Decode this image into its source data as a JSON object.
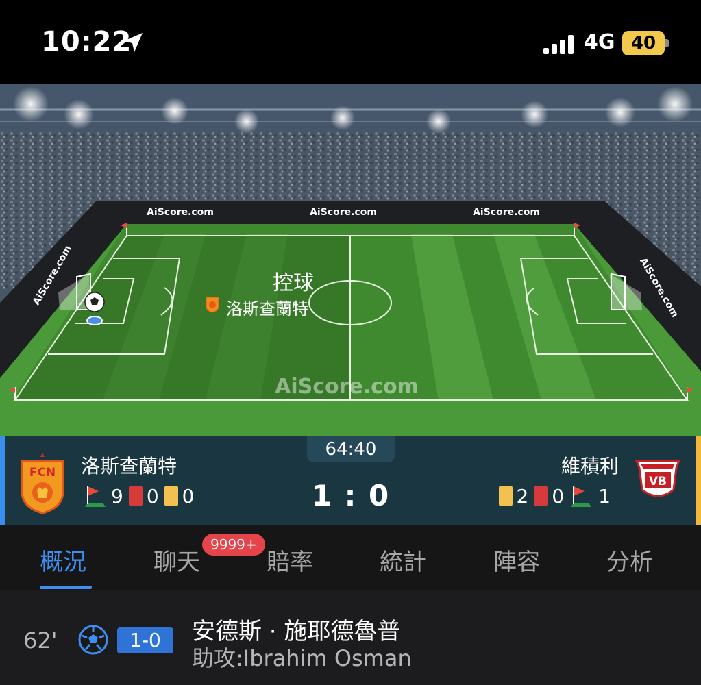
{
  "status_bar": {
    "time": "10:22",
    "network": "4G",
    "battery": "40",
    "icons": [
      "location-arrow-icon",
      "signal-bars-icon",
      "battery-icon"
    ]
  },
  "pitch": {
    "watermarks": [
      "AiScore.com",
      "AiScore.com",
      "AiScore.com",
      "AiScore.com",
      "AiScore.com",
      "AiScore.com"
    ],
    "possession_label": "控球",
    "possession_team": "洛斯查蘭特"
  },
  "match": {
    "clock": "64:40",
    "score": "1 : 0",
    "home": {
      "name": "洛斯查蘭特",
      "logo_text": "FCN",
      "corners": "9",
      "red_cards": "0",
      "yellow_cards": "0"
    },
    "away": {
      "name": "維積利",
      "logo_text": "VB",
      "yellow_cards": "2",
      "red_cards": "0",
      "corners": "1"
    }
  },
  "tabs": {
    "items": [
      "概況",
      "聊天",
      "賠率",
      "統計",
      "陣容",
      "分析"
    ],
    "active": "概況",
    "chat_badge": "9999+"
  },
  "event": {
    "minute": "62'",
    "score": "1-0",
    "scorer": "安德斯 · 施耶德魯普",
    "assist": "助攻:Ibrahim Osman"
  },
  "colors": {
    "accent_blue": "#3e8ef3",
    "home_side": "#3a8ef0",
    "away_side": "#f3b83b",
    "score_bar": "#193641",
    "battery": "#f2c94c",
    "badge_red": "#e5444a"
  }
}
